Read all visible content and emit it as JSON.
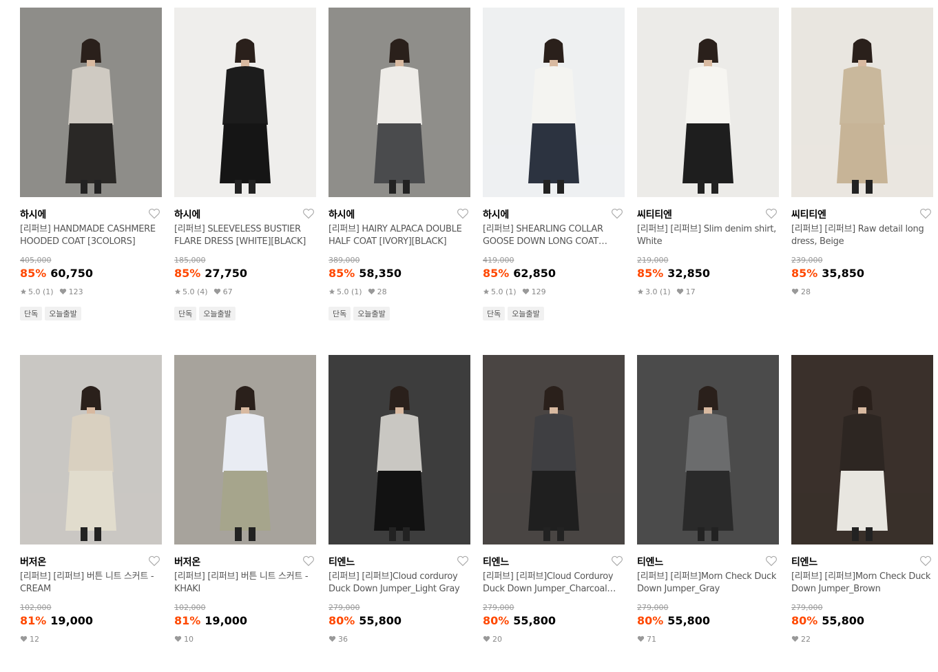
{
  "products": [
    {
      "brand": "하시에",
      "name": "[리퍼브] HANDMADE CASHMERE HOODED COAT [3COLORS]",
      "original_price": "405,000",
      "discount": "85%",
      "price": "60,750",
      "rating": "5.0 (1)",
      "likes": "123",
      "tags": [
        "단독",
        "오늘출발"
      ],
      "colors": {
        "bg": "#8e8d89",
        "top": "#cfcac2",
        "bottom": "#2a2826"
      }
    },
    {
      "brand": "하시에",
      "name": "[리퍼브] SLEEVELESS BUSTIER FLARE DRESS [WHITE][BLACK]",
      "original_price": "185,000",
      "discount": "85%",
      "price": "27,750",
      "rating": "5.0 (4)",
      "likes": "67",
      "tags": [
        "단독",
        "오늘출발"
      ],
      "colors": {
        "bg": "#efeeec",
        "top": "#1c1c1c",
        "bottom": "#151515"
      }
    },
    {
      "brand": "하시에",
      "name": "[리퍼브] HAIRY ALPACA DOUBLE HALF COAT [IVORY][BLACK]",
      "original_price": "389,000",
      "discount": "85%",
      "price": "58,350",
      "rating": "5.0 (1)",
      "likes": "28",
      "tags": [
        "단독",
        "오늘출발"
      ],
      "colors": {
        "bg": "#8f8e8a",
        "top": "#eeece8",
        "bottom": "#4a4b4d"
      }
    },
    {
      "brand": "하시에",
      "name": "[리퍼브] SHEARLING COLLAR GOOSE DOWN LONG COAT [IVORY][BLACK]",
      "original_price": "419,000",
      "discount": "85%",
      "price": "62,850",
      "rating": "5.0 (1)",
      "likes": "129",
      "tags": [
        "단독",
        "오늘출발"
      ],
      "colors": {
        "bg": "#eef0f1",
        "top": "#f4f4f1",
        "bottom": "#2c3340"
      }
    },
    {
      "brand": "씨티티엔",
      "name": "[리퍼브] [리퍼브] Slim denim shirt, White",
      "original_price": "219,000",
      "discount": "85%",
      "price": "32,850",
      "rating": "3.0 (1)",
      "likes": "17",
      "tags": [],
      "colors": {
        "bg": "#ecebe8",
        "top": "#f6f5f1",
        "bottom": "#1e1e1e"
      }
    },
    {
      "brand": "씨티티엔",
      "name": "[리퍼브] [리퍼브] Raw detail long dress, Beige",
      "original_price": "239,000",
      "discount": "85%",
      "price": "35,850",
      "rating": "",
      "likes": "28",
      "tags": [],
      "colors": {
        "bg": "#e9e6e0",
        "top": "#c9b89c",
        "bottom": "#c7b497"
      }
    },
    {
      "brand": "버저온",
      "name": "[리퍼브] [리퍼브] 버튼 니트 스커트 - CREAM",
      "original_price": "102,000",
      "discount": "81%",
      "price": "19,000",
      "rating": "",
      "likes": "12",
      "tags": [],
      "colors": {
        "bg": "#c9c7c3",
        "top": "#d9d0c0",
        "bottom": "#e1dccd"
      }
    },
    {
      "brand": "버저온",
      "name": "[리퍼브] [리퍼브] 버튼 니트 스커트 - KHAKI",
      "original_price": "102,000",
      "discount": "81%",
      "price": "19,000",
      "rating": "",
      "likes": "10",
      "tags": [],
      "colors": {
        "bg": "#a7a39c",
        "top": "#e9ecf3",
        "bottom": "#a6a58c"
      }
    },
    {
      "brand": "티엔느",
      "name": "[리퍼브] [리퍼브]Cloud corduroy Duck Down Jumper_Light Gray",
      "original_price": "279,000",
      "discount": "80%",
      "price": "55,800",
      "rating": "",
      "likes": "36",
      "tags": [],
      "colors": {
        "bg": "#3d3d3d",
        "top": "#c9c7c2",
        "bottom": "#121212"
      }
    },
    {
      "brand": "티엔느",
      "name": "[리퍼브] [리퍼브]Cloud Corduroy Duck Down Jumper_Charcoal Gray",
      "original_price": "279,000",
      "discount": "80%",
      "price": "55,800",
      "rating": "",
      "likes": "20",
      "tags": [],
      "colors": {
        "bg": "#4a4543",
        "top": "#3f3f42",
        "bottom": "#1f1f1f"
      }
    },
    {
      "brand": "티엔느",
      "name": "[리퍼브] [리퍼브]Morn Check Duck Down Jumper_Gray",
      "original_price": "279,000",
      "discount": "80%",
      "price": "55,800",
      "rating": "",
      "likes": "71",
      "tags": [],
      "colors": {
        "bg": "#4b4b4b",
        "top": "#6b6c6d",
        "bottom": "#2a2a2a"
      }
    },
    {
      "brand": "티엔느",
      "name": "[리퍼브] [리퍼브]Morn Check Duck Down Jumper_Brown",
      "original_price": "279,000",
      "discount": "80%",
      "price": "55,800",
      "rating": "",
      "likes": "22",
      "tags": [],
      "colors": {
        "bg": "#3a302b",
        "top": "#2d2622",
        "bottom": "#e8e6e0"
      }
    }
  ],
  "icons": {
    "heart": "heart-outline-icon",
    "star": "star-icon",
    "like": "heart-filled-icon"
  },
  "accent_color": "#ff4800"
}
